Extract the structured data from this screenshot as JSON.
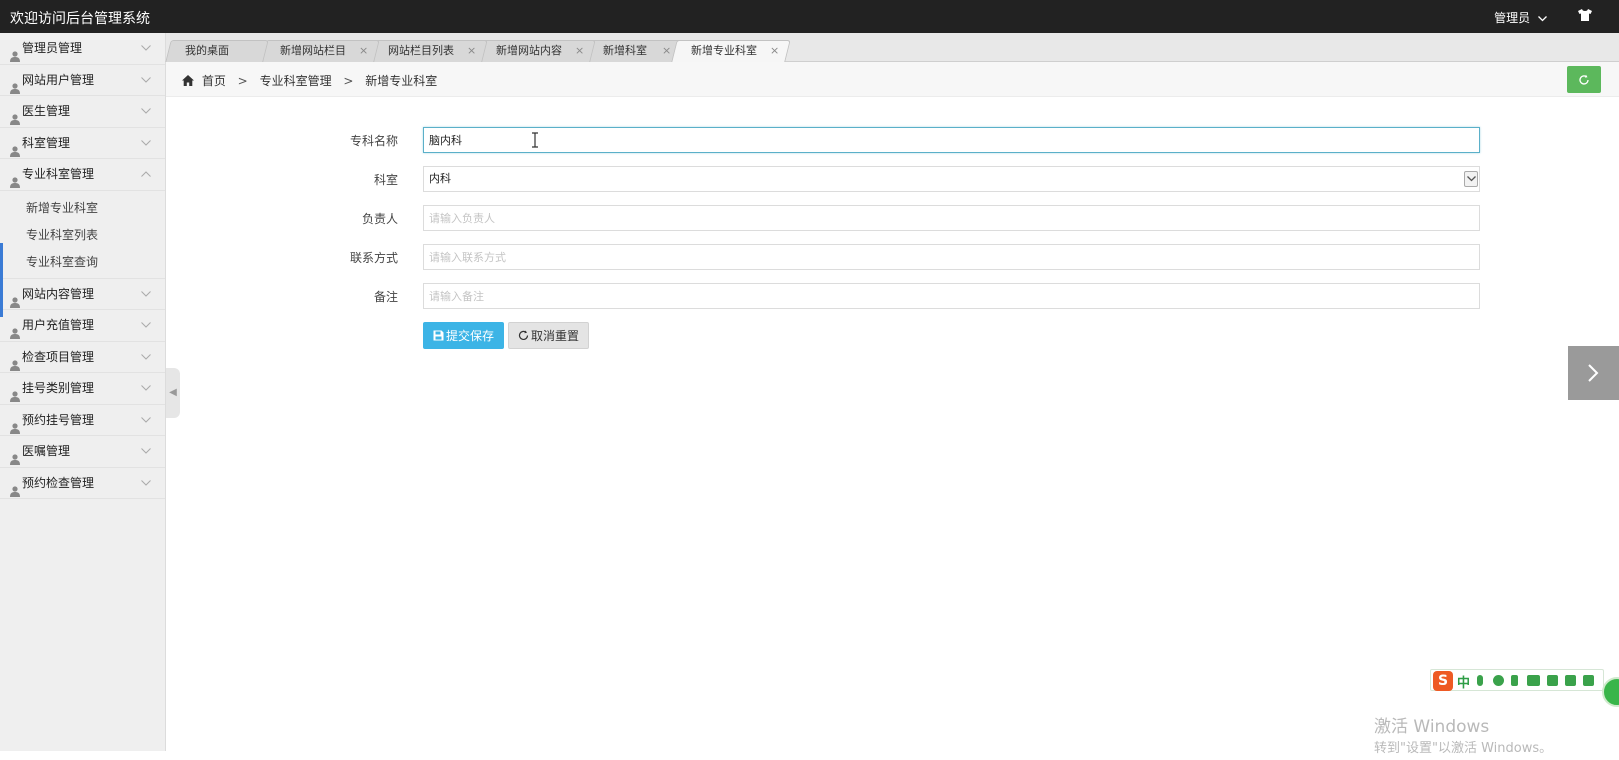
{
  "header": {
    "title": "欢迎访问后台管理系统",
    "user_label": "管理员",
    "chevron": "chevron-down-icon",
    "theme_icon": "shirt-icon"
  },
  "sidebar": {
    "items": [
      {
        "label": "管理员管理",
        "expanded": false
      },
      {
        "label": "网站用户管理",
        "expanded": false
      },
      {
        "label": "医生管理",
        "expanded": false
      },
      {
        "label": "科室管理",
        "expanded": false
      },
      {
        "label": "专业科室管理",
        "expanded": true,
        "children": [
          "新增专业科室",
          "专业科室列表",
          "专业科室查询"
        ]
      },
      {
        "label": "网站内容管理",
        "expanded": false
      },
      {
        "label": "用户充值管理",
        "expanded": false
      },
      {
        "label": "检查项目管理",
        "expanded": false
      },
      {
        "label": "挂号类别管理",
        "expanded": false
      },
      {
        "label": "预约挂号管理",
        "expanded": false
      },
      {
        "label": "医嘱管理",
        "expanded": false
      },
      {
        "label": "预约检查管理",
        "expanded": false
      }
    ],
    "accent_color": "#3a7bd5"
  },
  "tabs": [
    {
      "label": "我的桌面",
      "closable": false
    },
    {
      "label": "新增网站栏目",
      "closable": true
    },
    {
      "label": "网站栏目列表",
      "closable": true
    },
    {
      "label": "新增网站内容",
      "closable": true
    },
    {
      "label": "新增科室",
      "closable": true
    },
    {
      "label": "新增专业科室",
      "closable": true,
      "active": true
    }
  ],
  "tab_close_glyph": "×",
  "breadcrumb": {
    "home": "首页",
    "separator": ">",
    "level1": "专业科室管理",
    "level2": "新增专业科室"
  },
  "form": {
    "name_label": "专科名称",
    "name_value": "脑内科",
    "dept_label": "科室",
    "dept_value": "内科",
    "owner_label": "负责人",
    "owner_placeholder": "请输入负责人",
    "contact_label": "联系方式",
    "contact_placeholder": "请输入联系方式",
    "note_label": "备注",
    "note_placeholder": "请输入备注",
    "submit_label": "提交保存",
    "reset_label": "取消重置"
  },
  "colors": {
    "topbar": "#222222",
    "primary_button": "#3cb4e6",
    "refresh_button": "#5cb85c",
    "focus_border": "#5bb0c9"
  },
  "ime": {
    "logo": "S",
    "mode": "中"
  },
  "watermark": {
    "line1": "激活 Windows",
    "line2": "转到\"设置\"以激活 Windows。"
  }
}
